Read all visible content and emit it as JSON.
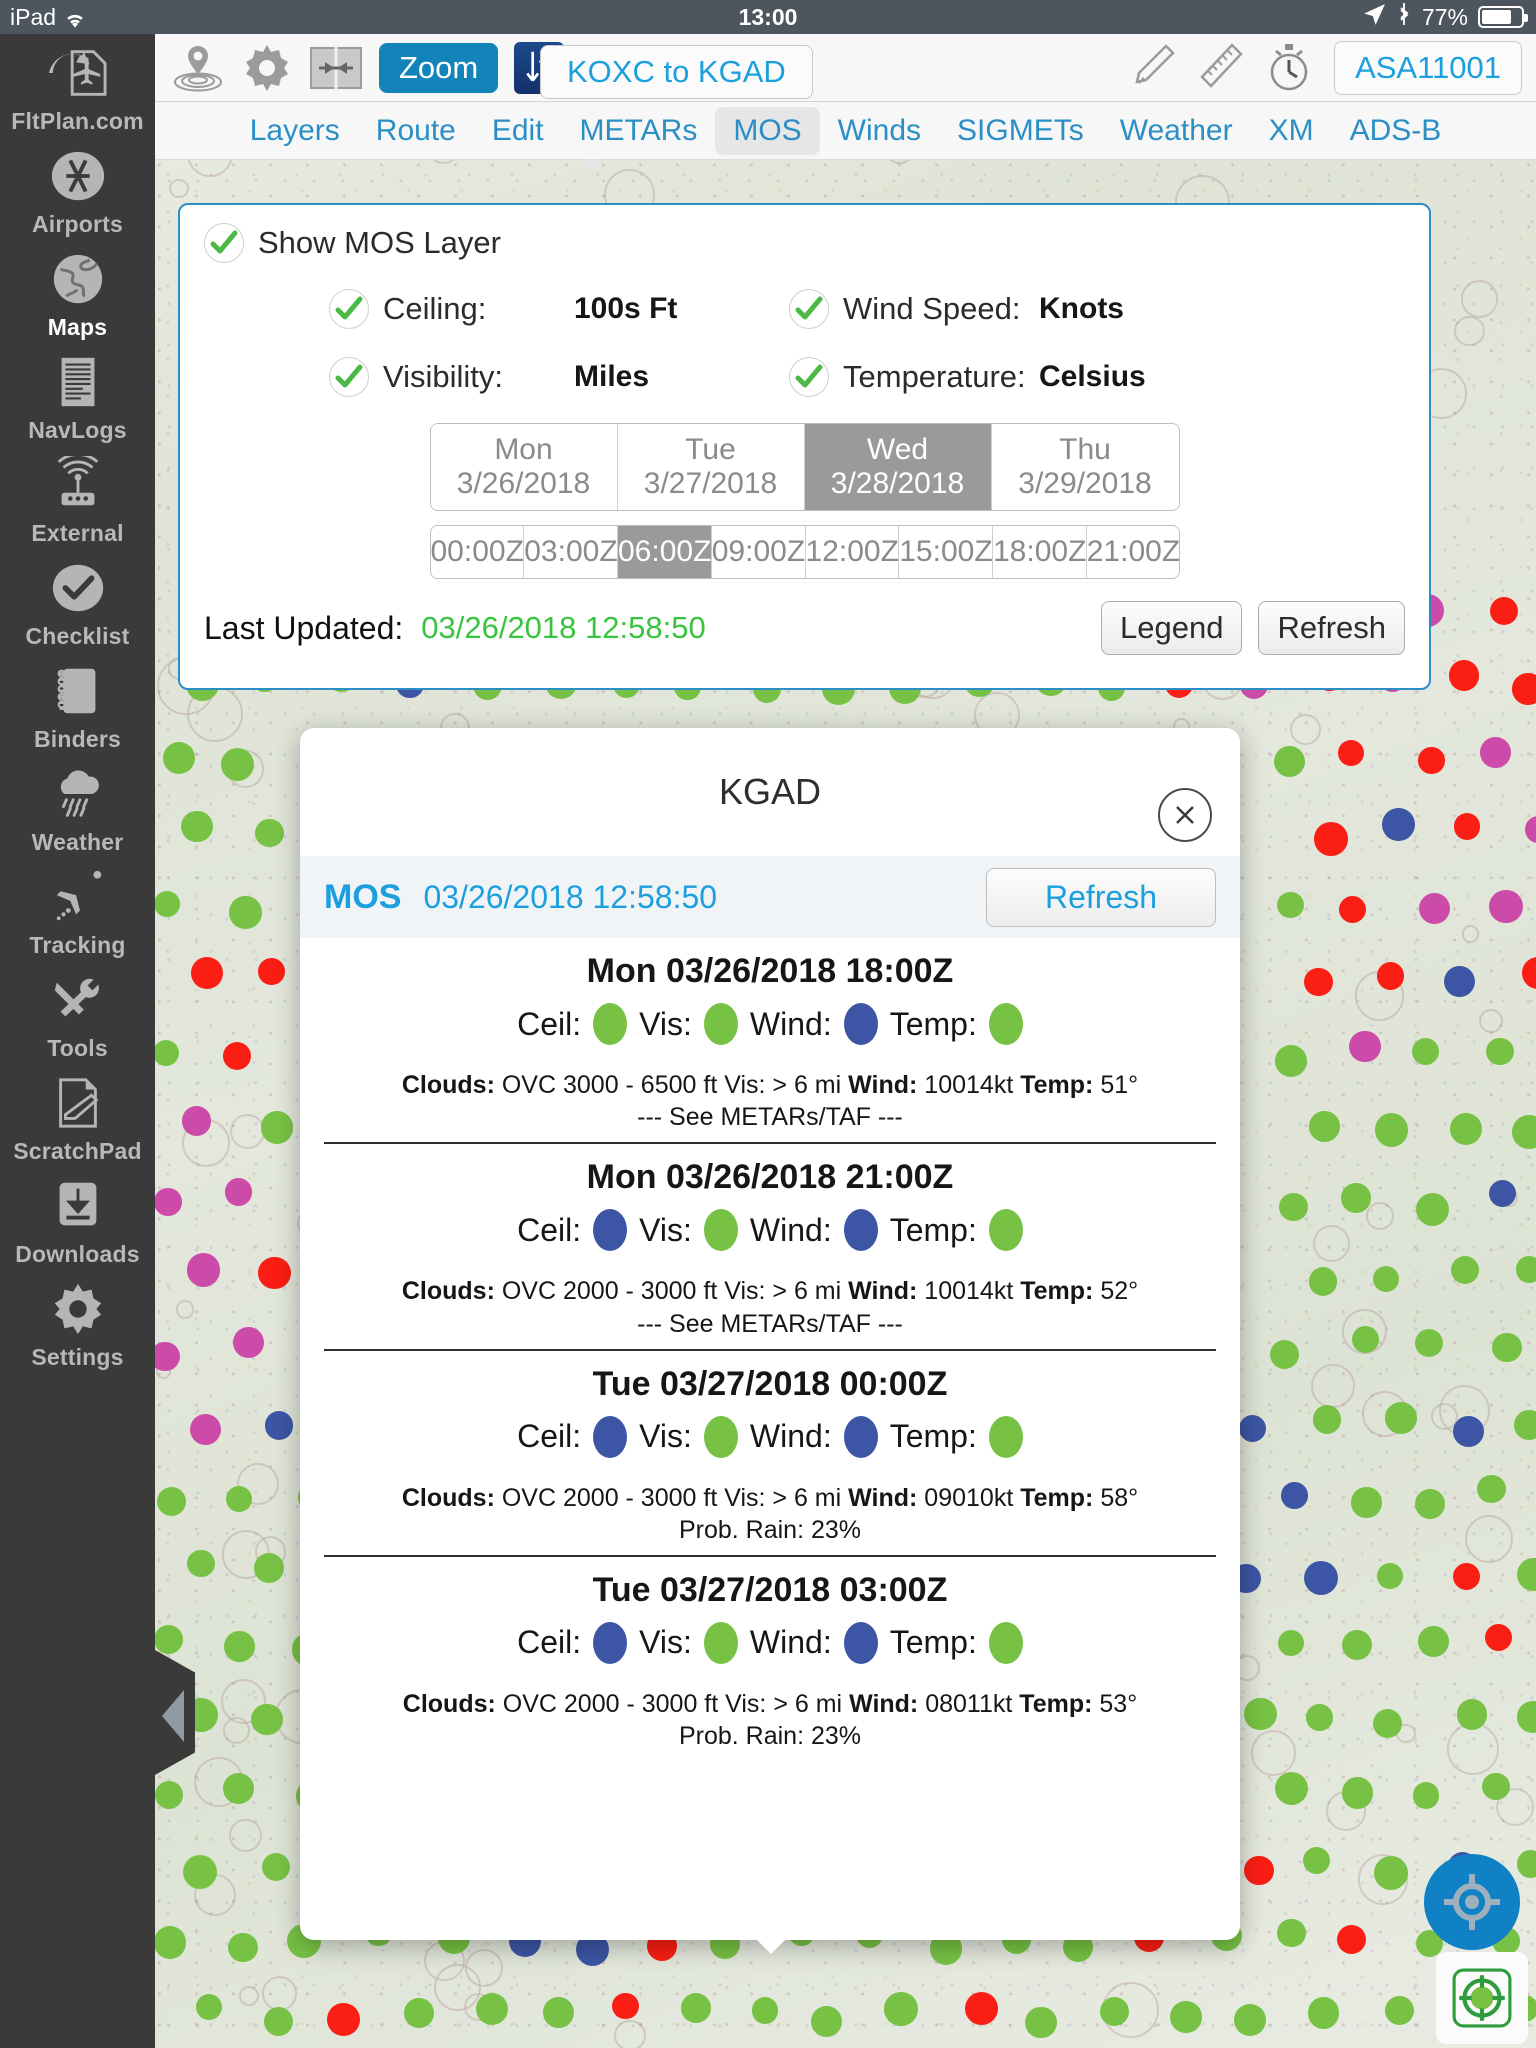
{
  "statusbar": {
    "device": "iPad",
    "wifi_icon": "wifi-icon",
    "time": "13:00",
    "location_icon": "location-arrow-icon",
    "bluetooth_icon": "bluetooth-icon",
    "battery_percent": "77%"
  },
  "sidebar": {
    "items": [
      {
        "label": "FltPlan.com",
        "icon": "fltplan-logo-icon",
        "active": false
      },
      {
        "label": "Airports",
        "icon": "airports-icon",
        "active": false
      },
      {
        "label": "Maps",
        "icon": "globe-icon",
        "active": true
      },
      {
        "label": "NavLogs",
        "icon": "document-lines-icon",
        "active": false
      },
      {
        "label": "External",
        "icon": "wireless-router-icon",
        "active": false
      },
      {
        "label": "Checklist",
        "icon": "checkmark-circle-icon",
        "active": false
      },
      {
        "label": "Binders",
        "icon": "notebook-icon",
        "active": false
      },
      {
        "label": "Weather",
        "icon": "rain-cloud-icon",
        "active": false
      },
      {
        "label": "Tracking",
        "icon": "airplane-track-icon",
        "active": false
      },
      {
        "label": "Tools",
        "icon": "wrench-screwdriver-icon",
        "active": false
      },
      {
        "label": "ScratchPad",
        "icon": "note-pencil-icon",
        "active": false
      },
      {
        "label": "Downloads",
        "icon": "download-arrow-icon",
        "active": false
      },
      {
        "label": "Settings",
        "icon": "gear-icon",
        "active": false
      }
    ]
  },
  "toolbar": {
    "location_icon": "location-pin-ripple-icon",
    "settings_icon": "gear-icon",
    "split_icon": "split-screen-icon",
    "zoom_label": "Zoom",
    "swap_icon": "swap-arrows-icon",
    "route_label": "KOXC to KGAD",
    "pencil_icon": "pencil-icon",
    "ruler_icon": "ruler-icon",
    "stopwatch_icon": "stopwatch-icon",
    "tail_number": "ASA11001"
  },
  "tabs": {
    "items": [
      {
        "label": "Layers",
        "active": false
      },
      {
        "label": "Route",
        "active": false
      },
      {
        "label": "Edit",
        "active": false
      },
      {
        "label": "METARs",
        "active": false
      },
      {
        "label": "MOS",
        "active": true
      },
      {
        "label": "Winds",
        "active": false
      },
      {
        "label": "SIGMETs",
        "active": false
      },
      {
        "label": "Weather",
        "active": false
      },
      {
        "label": "XM",
        "active": false
      },
      {
        "label": "ADS-B",
        "active": false
      }
    ]
  },
  "mos_panel": {
    "show_layer_label": "Show MOS Layer",
    "show_layer_checked": true,
    "options": [
      {
        "label": "Ceiling:",
        "unit": "100s Ft",
        "checked": true
      },
      {
        "label": "Wind Speed:",
        "unit": "Knots",
        "checked": true
      },
      {
        "label": "Visibility:",
        "unit": "Miles",
        "checked": true
      },
      {
        "label": "Temperature:",
        "unit": "Celsius",
        "checked": true
      }
    ],
    "days": [
      {
        "label": "Mon 3/26/2018",
        "selected": false
      },
      {
        "label": "Tue 3/27/2018",
        "selected": false
      },
      {
        "label": "Wed 3/28/2018",
        "selected": true
      },
      {
        "label": "Thu 3/29/2018",
        "selected": false
      }
    ],
    "times": [
      {
        "label": "00:00Z",
        "selected": false
      },
      {
        "label": "03:00Z",
        "selected": false
      },
      {
        "label": "06:00Z",
        "selected": true
      },
      {
        "label": "09:00Z",
        "selected": false
      },
      {
        "label": "12:00Z",
        "selected": false
      },
      {
        "label": "15:00Z",
        "selected": false
      },
      {
        "label": "18:00Z",
        "selected": false
      },
      {
        "label": "21:00Z",
        "selected": false
      }
    ],
    "last_updated_label": "Last Updated:",
    "last_updated_value": "03/26/2018 12:58:50",
    "legend_label": "Legend",
    "refresh_label": "Refresh"
  },
  "popup": {
    "title": "KGAD",
    "close_icon": "close-icon",
    "mos_tag": "MOS",
    "timestamp": "03/26/2018 12:58:50",
    "refresh_label": "Refresh",
    "labels": {
      "ceil": "Ceil:",
      "vis": "Vis:",
      "wind": "Wind:",
      "temp": "Temp:"
    },
    "forecasts": [
      {
        "time": "Mon 03/26/2018 18:00Z",
        "ceil_color": "#77c244",
        "vis_color": "#77c244",
        "wind_color": "#3c56a5",
        "temp_color": "#77c244",
        "clouds_label": "Clouds:",
        "clouds_value": "OVC 3000 - 6500 ft",
        "vis_label": "Vis:",
        "vis_value": "> 6 mi",
        "wind_label": "Wind:",
        "wind_value": "10014kt",
        "temp_label": "Temp:",
        "temp_value": "51°",
        "note": "--- See METARs/TAF ---"
      },
      {
        "time": "Mon 03/26/2018 21:00Z",
        "ceil_color": "#3c56a5",
        "vis_color": "#77c244",
        "wind_color": "#3c56a5",
        "temp_color": "#77c244",
        "clouds_label": "Clouds:",
        "clouds_value": "OVC 2000 - 3000 ft",
        "vis_label": "Vis:",
        "vis_value": "> 6 mi",
        "wind_label": "Wind:",
        "wind_value": "10014kt",
        "temp_label": "Temp:",
        "temp_value": "52°",
        "note": "--- See METARs/TAF ---"
      },
      {
        "time": "Tue 03/27/2018 00:00Z",
        "ceil_color": "#3c56a5",
        "vis_color": "#77c244",
        "wind_color": "#3c56a5",
        "temp_color": "#77c244",
        "clouds_label": "Clouds:",
        "clouds_value": "OVC 2000 - 3000 ft",
        "vis_label": "Vis:",
        "vis_value": "> 6 mi",
        "wind_label": "Wind:",
        "wind_value": "09010kt",
        "temp_label": "Temp:",
        "temp_value": "58°",
        "note": "Prob. Rain: 23%"
      },
      {
        "time": "Tue 03/27/2018 03:00Z",
        "ceil_color": "#3c56a5",
        "vis_color": "#77c244",
        "wind_color": "#3c56a5",
        "temp_color": "#77c244",
        "clouds_label": "Clouds:",
        "clouds_value": "OVC 2000 - 3000 ft",
        "vis_label": "Vis:",
        "vis_value": "> 6 mi",
        "wind_label": "Wind:",
        "wind_value": "08011kt",
        "temp_label": "Temp:",
        "temp_value": "53°",
        "note": "Prob. Rain: 23%"
      }
    ]
  },
  "map_controls": {
    "locate_icon": "crosshair-locate-icon",
    "center_icon": "crosshair-center-icon"
  },
  "colors": {
    "accent_blue": "#1ba0dd",
    "tab_blue": "#2b8fc6",
    "zoom_blue": "#1284b9",
    "green": "#39c43f",
    "mos_green": "#77c244",
    "mos_blue": "#3c56a5",
    "mos_red": "#fa1e14",
    "mos_magenta": "#cc4ba8",
    "status_bg": "#4d565f",
    "sidebar_bg": "#3a3a3a"
  }
}
